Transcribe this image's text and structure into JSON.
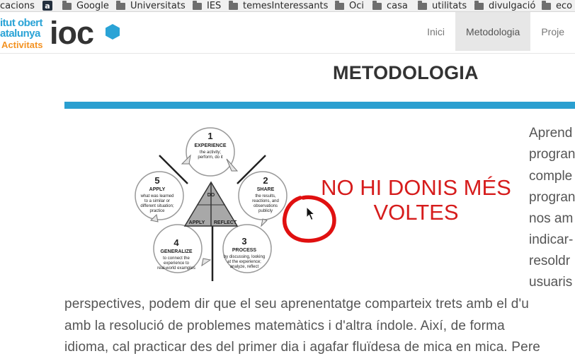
{
  "bookmarks": [
    {
      "label": "cacions",
      "icon": "none"
    },
    {
      "label": "",
      "icon": "amazon-icon"
    },
    {
      "label": "Google",
      "icon": "folder-icon"
    },
    {
      "label": "Universitats",
      "icon": "folder-icon"
    },
    {
      "label": "IES",
      "icon": "folder-icon"
    },
    {
      "label": "temesInteressants",
      "icon": "folder-icon"
    },
    {
      "label": "Oci",
      "icon": "folder-icon"
    },
    {
      "label": "casa",
      "icon": "folder-icon"
    },
    {
      "label": "utilitats",
      "icon": "folder-icon"
    },
    {
      "label": "divulgació",
      "icon": "folder-icon"
    },
    {
      "label": "eco",
      "icon": "folder-icon"
    }
  ],
  "logo": {
    "line1": "itut obert",
    "line2": "atalunya",
    "line3": "Activitats",
    "mark": "ioc",
    "colors": {
      "blue": "#2aa3d6",
      "orange": "#f39222",
      "dark": "#333333"
    }
  },
  "nav": {
    "items": [
      {
        "label": "Inici",
        "active": false
      },
      {
        "label": "Metodologia",
        "active": true
      },
      {
        "label": "Proje",
        "active": false
      }
    ]
  },
  "page": {
    "title": "METODOLOGIA",
    "accent_color": "#2a9fd0"
  },
  "diagram": {
    "center": {
      "top": "DO",
      "left": "APPLY",
      "right": "REFLECT"
    },
    "stages": [
      {
        "num": "1",
        "title": "EXPERIENCE",
        "desc": [
          "the activity;",
          "perform, do it"
        ]
      },
      {
        "num": "2",
        "title": "SHARE",
        "desc": [
          "the results,",
          "reactions, and",
          "observations",
          "publicly"
        ]
      },
      {
        "num": "3",
        "title": "PROCESS",
        "desc": [
          "by discussing, looking",
          "at the experience;",
          "analyze, reflect"
        ]
      },
      {
        "num": "4",
        "title": "GENERALIZE",
        "desc": [
          "to connect the",
          "experience to",
          "real-world examples"
        ]
      },
      {
        "num": "5",
        "title": "APPLY",
        "desc": [
          "what was learned",
          "to a similar or",
          "different situation;",
          "practice"
        ]
      }
    ]
  },
  "annotation": {
    "lines": [
      "NO HI DONIS MÉS",
      "VOLTES"
    ],
    "color": "#d61c1c"
  },
  "right_column": [
    "Aprend",
    "progran",
    "comple",
    "progran",
    "nos am",
    "indicar-",
    "resoldr",
    "usuaris"
  ],
  "paragraph": [
    "perspectives, podem dir que el seu aprenentatge comparteix trets amb el d'u",
    "amb la resolució de problemes matemàtics i d'altra índole. Així, de forma",
    "idioma, cal practicar des del primer dia i agafar fluïdesa de mica en mica. Pere"
  ]
}
